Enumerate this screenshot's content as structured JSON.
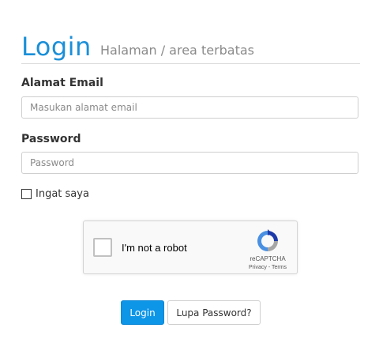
{
  "header": {
    "title": "Login",
    "subtitle": "Halaman / area terbatas"
  },
  "form": {
    "email_label": "Alamat Email",
    "email_placeholder": "Masukan alamat email",
    "email_value": "",
    "password_label": "Password",
    "password_placeholder": "Password",
    "password_value": "",
    "remember_label": "Ingat saya",
    "remember_checked": false
  },
  "captcha": {
    "label": "I'm not a robot",
    "brand": "reCAPTCHA",
    "privacy": "Privacy",
    "separator": " - ",
    "terms": "Terms",
    "icon": "recaptcha-logo-icon"
  },
  "buttons": {
    "login_label": "Login",
    "forgot_label": "Lupa Password?"
  },
  "colors": {
    "accent": "#1a8fd8",
    "primary_button": "#0d95e8"
  }
}
